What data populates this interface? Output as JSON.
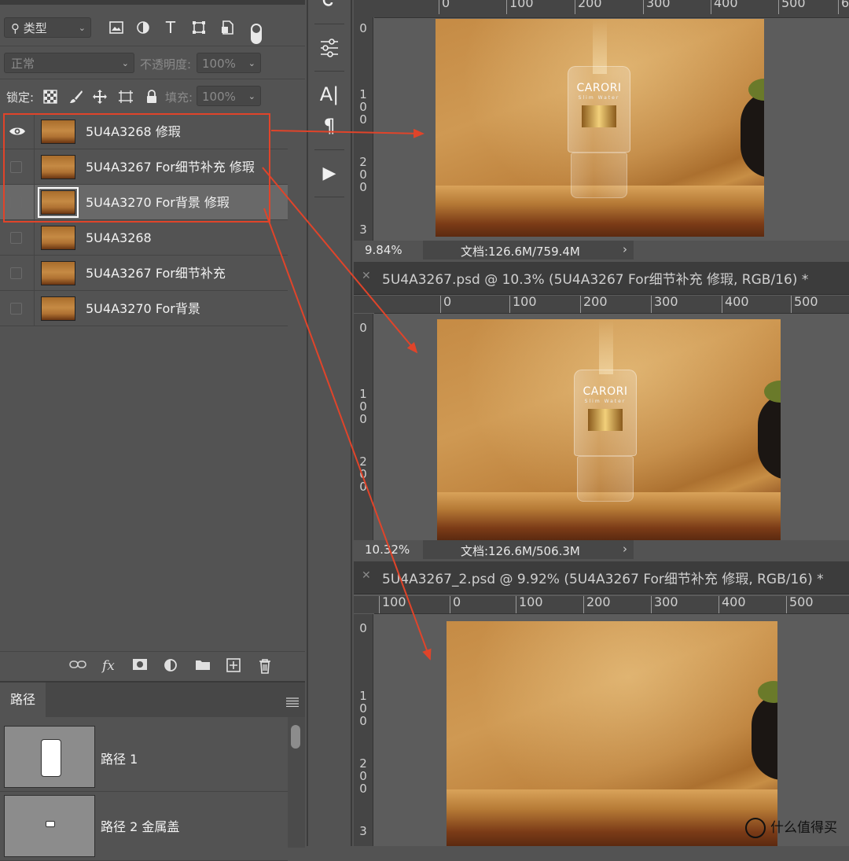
{
  "layers_panel": {
    "filter": {
      "label": "类型"
    },
    "blend_mode": "正常",
    "opacity_label": "不透明度:",
    "opacity_value": "100%",
    "lock_label": "锁定:",
    "fill_label": "填充:",
    "fill_value": "100%",
    "layers": [
      {
        "name": "5U4A3268 修瑕",
        "visible": true
      },
      {
        "name": "5U4A3267 For细节补充 修瑕",
        "visible": false
      },
      {
        "name": "5U4A3270 For背景 修瑕",
        "visible": false,
        "selected": true
      },
      {
        "name": "5U4A3268",
        "visible": false
      },
      {
        "name": "5U4A3267 For细节补充",
        "visible": false
      },
      {
        "name": "5U4A3270 For背景",
        "visible": false
      }
    ],
    "bottom_fx": "fx"
  },
  "paths_panel": {
    "tab": "路径",
    "paths": [
      {
        "name": "路径 1"
      },
      {
        "name": "路径 2 金属盖"
      }
    ]
  },
  "documents": [
    {
      "zoom": "9.84%",
      "file_info": "文档:126.6M/759.4M",
      "ruler_h": [
        "0",
        "100",
        "200",
        "300",
        "400",
        "500",
        "6"
      ],
      "ruler_v": [
        "0",
        "1\n0\n0",
        "2\n0\n0",
        "3"
      ]
    },
    {
      "title": "5U4A3267.psd @ 10.3% (5U4A3267 For细节补充 修瑕, RGB/16) *",
      "zoom": "10.32%",
      "file_info": "文档:126.6M/506.3M",
      "ruler_h": [
        "0",
        "100",
        "200",
        "300",
        "400",
        "500"
      ],
      "ruler_v": [
        "0",
        "1\n0\n0",
        "2\n0\n0"
      ]
    },
    {
      "title": "5U4A3267_2.psd @ 9.92% (5U4A3267 For细节补充 修瑕, RGB/16) *",
      "ruler_h": [
        "100",
        "0",
        "100",
        "200",
        "300",
        "400",
        "500"
      ],
      "ruler_v": [
        "0",
        "1\n0\n0",
        "2\n0\n0",
        "3"
      ]
    }
  ],
  "bottle": {
    "brand": "CARORI",
    "sub": "Slim Water"
  },
  "tool_strip": {
    "type_tool": "A|",
    "paragraph": "¶",
    "play": "▶"
  },
  "watermark": "什么值得买",
  "colors": {
    "annotation": "#e0442a",
    "panel_bg": "#535353",
    "selected_row": "#696969"
  }
}
